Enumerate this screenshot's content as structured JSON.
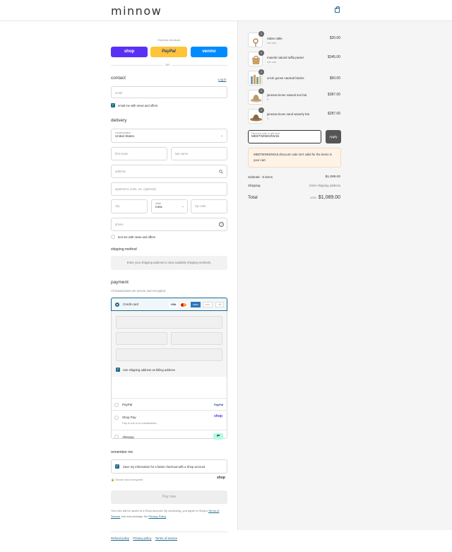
{
  "header": {
    "logo": "minnow"
  },
  "express": {
    "label": "Express checkout",
    "shop": "shop",
    "paypal": "PayPal",
    "venmo": "venmo",
    "or": "OR"
  },
  "contact": {
    "title": "contact",
    "login": "Log in",
    "email_placeholder": "email",
    "news_label": "email me with news and offers"
  },
  "delivery": {
    "title": "delivery",
    "country_label": "country/region",
    "country_value": "United States",
    "first_name": "first name",
    "last_name": "last name",
    "address": "address",
    "apartment": "apartment, suite, etc. (optional)",
    "city": "city",
    "state_label": "State",
    "state_value": "Iowa",
    "zip": "zip code",
    "phone": "phone",
    "text_me": "text me with news and offers"
  },
  "shipping": {
    "title": "shipping method",
    "notice": "Enter your shipping address to view available shipping methods."
  },
  "payment": {
    "title": "payment",
    "subtitle": "All transactions are secure and encrypted.",
    "credit_card": "Credit card",
    "card_brands": [
      "VISA",
      "MC",
      "AMEX",
      "DISC"
    ],
    "more_brands": "+4",
    "billing_label": "Use shipping address as billing address",
    "paypal": "PayPal",
    "paypal_logo": "PayPal",
    "shoppay": "Shop Pay",
    "shoppay_sub": "Pay in full or in installments",
    "shoppay_logo": "shop",
    "afterpay": "Afterpay"
  },
  "remember": {
    "title": "remember me",
    "save_label": "Save my information for a faster checkout with a Shop account",
    "secure": "Secure and encrypted",
    "shop_logo": "shop"
  },
  "pay_button": "Pay now",
  "legal": {
    "text1": "Your info will be saved to a Shop account. By continuing, you agree to Shop's",
    "terms": "Terms of Service",
    "text2": "and acknowledge the",
    "privacy": "Privacy Policy",
    "period": "."
  },
  "footer_links": [
    "Refund policy",
    "Privacy policy",
    "Terms of service"
  ],
  "cart": {
    "items": [
      {
        "name": "rattan rattle",
        "sub": "one size",
        "price": "$20.00",
        "qty": "1"
      },
      {
        "name": "manebi natural raffia panier",
        "sub": "one size",
        "price": "$345.00",
        "qty": "1"
      },
      {
        "name": "uncle goose nautical blocks",
        "sub": "",
        "price": "$50.00",
        "qty": "1"
      },
      {
        "name": "janessa leone natural sun hat",
        "sub": "S",
        "price": "$387.00",
        "qty": "1"
      },
      {
        "name": "janessa leone sand waverly hat",
        "sub": "S",
        "price": "$287.00",
        "qty": "1"
      }
    ],
    "discount_label": "Discount code or gift card",
    "discount_value": "MEETMINNOW15",
    "apply": "Apply",
    "error": "MEETMINNOW15 discount code isn't valid for the items in your cart.",
    "subtotal_label": "Subtotal · 5 items",
    "subtotal": "$1,089.00",
    "shipping_label": "Shipping",
    "shipping_value": "Enter shipping address",
    "total_label": "Total",
    "currency": "USD",
    "total": "$1,089.00"
  }
}
